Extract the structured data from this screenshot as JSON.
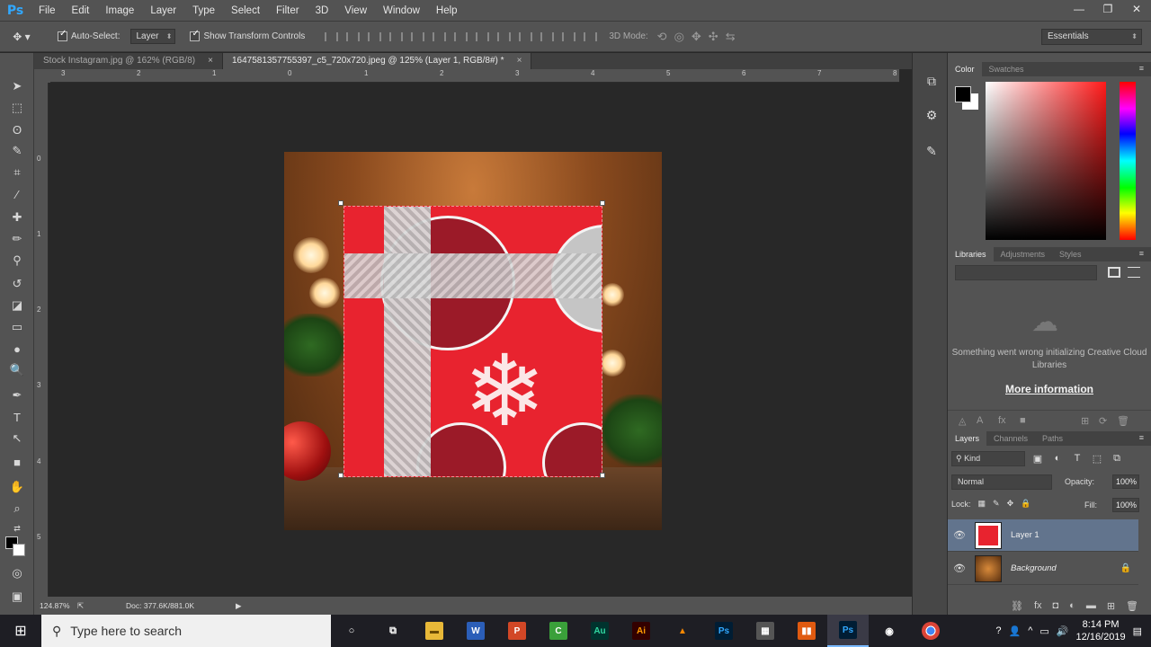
{
  "app": {
    "logo": "Ps"
  },
  "menu": [
    "File",
    "Edit",
    "Image",
    "Layer",
    "Type",
    "Select",
    "Filter",
    "3D",
    "View",
    "Window",
    "Help"
  ],
  "window_controls": {
    "minimize": "—",
    "restore": "❐",
    "close": "✕"
  },
  "options": {
    "auto_select_label": "Auto-Select:",
    "auto_select_target": "Layer",
    "show_transform_label": "Show Transform Controls",
    "mode_3d": "3D Mode:",
    "workspace": "Essentials"
  },
  "tabs": [
    {
      "label": "Stock Instagram.jpg @ 162% (RGB/8)",
      "close": "×"
    },
    {
      "label": "1647581357755397_c5_720x720.jpeg @ 125% (Layer 1, RGB/8#) *",
      "close": "×"
    }
  ],
  "rulers": {
    "h": [
      "3",
      "2",
      "1",
      "0",
      "1",
      "2",
      "3",
      "4",
      "5",
      "6",
      "7",
      "8"
    ],
    "v": [
      "0",
      "1",
      "2",
      "3",
      "4",
      "5"
    ]
  },
  "status": {
    "zoom": "124.87%",
    "doc": "Doc: 377.6K/881.0K"
  },
  "panels": {
    "color_tabs": [
      "Color",
      "Swatches"
    ],
    "library_tabs": [
      "Libraries",
      "Adjustments",
      "Styles"
    ],
    "library_error": "Something went wrong initializing Creative Cloud Libraries",
    "library_link": "More information",
    "layer_tabs": [
      "Layers",
      "Channels",
      "Paths"
    ],
    "kind_filter": "Kind",
    "blend_mode": "Normal",
    "opacity_label": "Opacity:",
    "opacity": "100%",
    "lock_label": "Lock:",
    "fill_label": "Fill:",
    "fill": "100%",
    "menu_glyph": "≡"
  },
  "layers": [
    {
      "name": "Layer 1",
      "selected": true
    },
    {
      "name": "Background",
      "selected": false
    }
  ],
  "taskbar": {
    "search_placeholder": "Type here to search",
    "apps": [
      "W",
      "P",
      "Au",
      "Ai",
      "Ps"
    ],
    "time": "8:14 PM",
    "date": "12/16/2019"
  },
  "colors": {
    "accent": "#31a8ff",
    "gift_red": "#e8232f",
    "selected_layer": "#62748d"
  }
}
